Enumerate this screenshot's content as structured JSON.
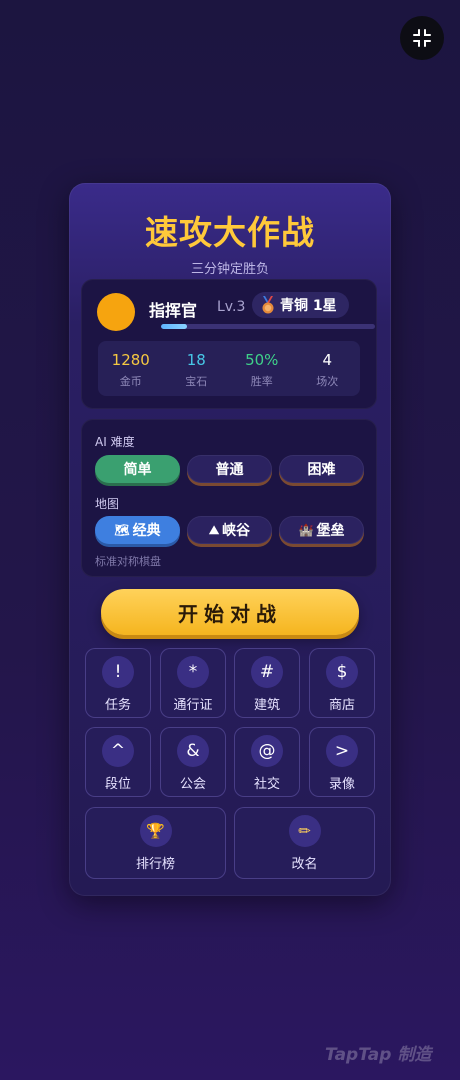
{
  "header": {
    "minimize_icon": "collapse-arrows-icon"
  },
  "game": {
    "title": "速攻大作战",
    "subtitle": "三分钟定胜负"
  },
  "profile": {
    "name": "指挥官",
    "level": "Lv.3",
    "rank_icon": "bronze-medal-icon",
    "rank": "青铜 1星",
    "xp_fraction": 0.12,
    "stats": [
      {
        "value": "1280",
        "label": "金币",
        "color": "#f5c842"
      },
      {
        "value": "18",
        "label": "宝石",
        "color": "#47c7e6"
      },
      {
        "value": "50%",
        "label": "胜率",
        "color": "#3fd18a"
      },
      {
        "value": "4",
        "label": "场次",
        "color": "#ffffff"
      }
    ]
  },
  "settings": {
    "difficulty_label": "AI 难度",
    "difficulty_options": [
      "简单",
      "普通",
      "困难"
    ],
    "difficulty_selected": "简单",
    "map_label": "地图",
    "map_options": [
      {
        "icon": "map-icon",
        "glyph": "🗺",
        "label": "经典"
      },
      {
        "icon": "canyon-icon",
        "glyph": "⛰",
        "label": "峡谷"
      },
      {
        "icon": "castle-icon",
        "glyph": "🏰",
        "label": "堡垒"
      }
    ],
    "map_selected": "经典",
    "map_description": "标准对称棋盘"
  },
  "start_button": "开始对战",
  "menu": [
    {
      "glyph": "!",
      "label": "任务"
    },
    {
      "glyph": "*",
      "label": "通行证"
    },
    {
      "glyph": "#",
      "label": "建筑"
    },
    {
      "glyph": "$",
      "label": "商店"
    },
    {
      "glyph": "^",
      "label": "段位"
    },
    {
      "glyph": "&",
      "label": "公会"
    },
    {
      "glyph": "@",
      "label": "社交"
    },
    {
      "glyph": ">",
      "label": "录像"
    },
    {
      "glyph": "🏆",
      "label": "排行榜"
    },
    {
      "glyph": "✏",
      "label": "改名"
    }
  ],
  "watermark": "TapTap 制造",
  "colors": {
    "title": "#ffc93a",
    "start_button": "#f8bf2b",
    "selected_green": "#3aa070",
    "selected_blue": "#3e7fe0"
  }
}
